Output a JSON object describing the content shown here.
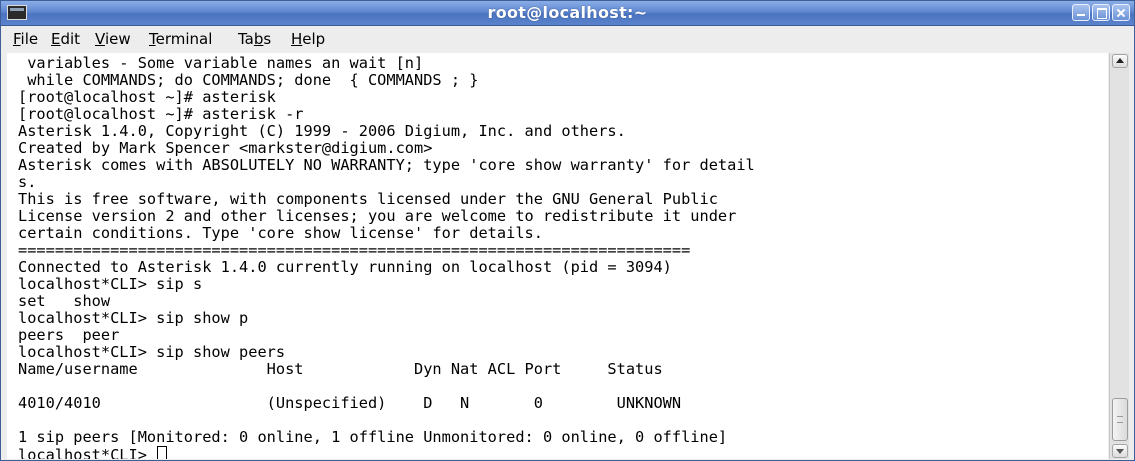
{
  "window": {
    "title": "root@localhost:~",
    "colors": {
      "titlebar": "#5f87cf",
      "terminal_bg": "#ffffff",
      "terminal_fg": "#000000"
    }
  },
  "menu": [
    {
      "mnemonic": "F",
      "rest": "ile"
    },
    {
      "mnemonic": "E",
      "rest": "dit"
    },
    {
      "mnemonic": "V",
      "rest": "iew"
    },
    {
      "mnemonic": "T",
      "rest": "erminal"
    },
    {
      "prefix": "Ta",
      "mnemonic": "b",
      "rest": "s"
    },
    {
      "mnemonic": "H",
      "rest": "elp"
    }
  ],
  "terminal": {
    "lines": [
      " variables - Some variable names an wait [n]",
      " while COMMANDS; do COMMANDS; done  { COMMANDS ; }",
      "[root@localhost ~]# asterisk",
      "[root@localhost ~]# asterisk -r",
      "Asterisk 1.4.0, Copyright (C) 1999 - 2006 Digium, Inc. and others.",
      "Created by Mark Spencer <markster@digium.com>",
      "Asterisk comes with ABSOLUTELY NO WARRANTY; type 'core show warranty' for detail",
      "s.",
      "This is free software, with components licensed under the GNU General Public",
      "License version 2 and other licenses; you are welcome to redistribute it under",
      "certain conditions. Type 'core show license' for details.",
      "=========================================================================",
      "Connected to Asterisk 1.4.0 currently running on localhost (pid = 3094)",
      "localhost*CLI> sip s",
      "set   show",
      "localhost*CLI> sip show p",
      "peers  peer",
      "localhost*CLI> sip show peers",
      "Name/username              Host            Dyn Nat ACL Port     Status",
      "",
      "4010/4010                  (Unspecified)    D   N       0        UNKNOWN",
      "",
      "1 sip peers [Monitored: 0 online, 1 offline Unmonitored: 0 online, 0 offline]"
    ],
    "prompt": "localhost*CLI> "
  }
}
